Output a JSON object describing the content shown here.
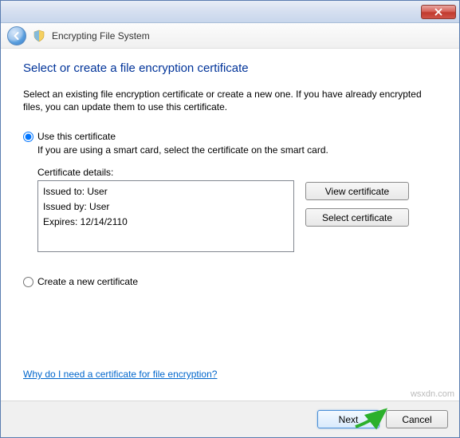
{
  "window": {
    "title": "Encrypting File System"
  },
  "page": {
    "heading": "Select or create a file encryption certificate",
    "description": "Select an existing file encryption certificate or create a new one. If you have already encrypted files, you can update them to use this certificate."
  },
  "option_use": {
    "label": "Use this certificate",
    "subtext": "If you are using a smart card, select the certificate on the smart card.",
    "details_label": "Certificate details:",
    "issued_to": "Issued to: User",
    "issued_by": "Issued by: User",
    "expires": "Expires: 12/14/2110"
  },
  "buttons": {
    "view_cert": "View certificate",
    "select_cert": "Select certificate",
    "next": "Next",
    "cancel": "Cancel"
  },
  "option_create": {
    "label": "Create a new certificate"
  },
  "help": {
    "link": "Why do I need a certificate for file encryption?"
  },
  "watermark": "wsxdn.com"
}
